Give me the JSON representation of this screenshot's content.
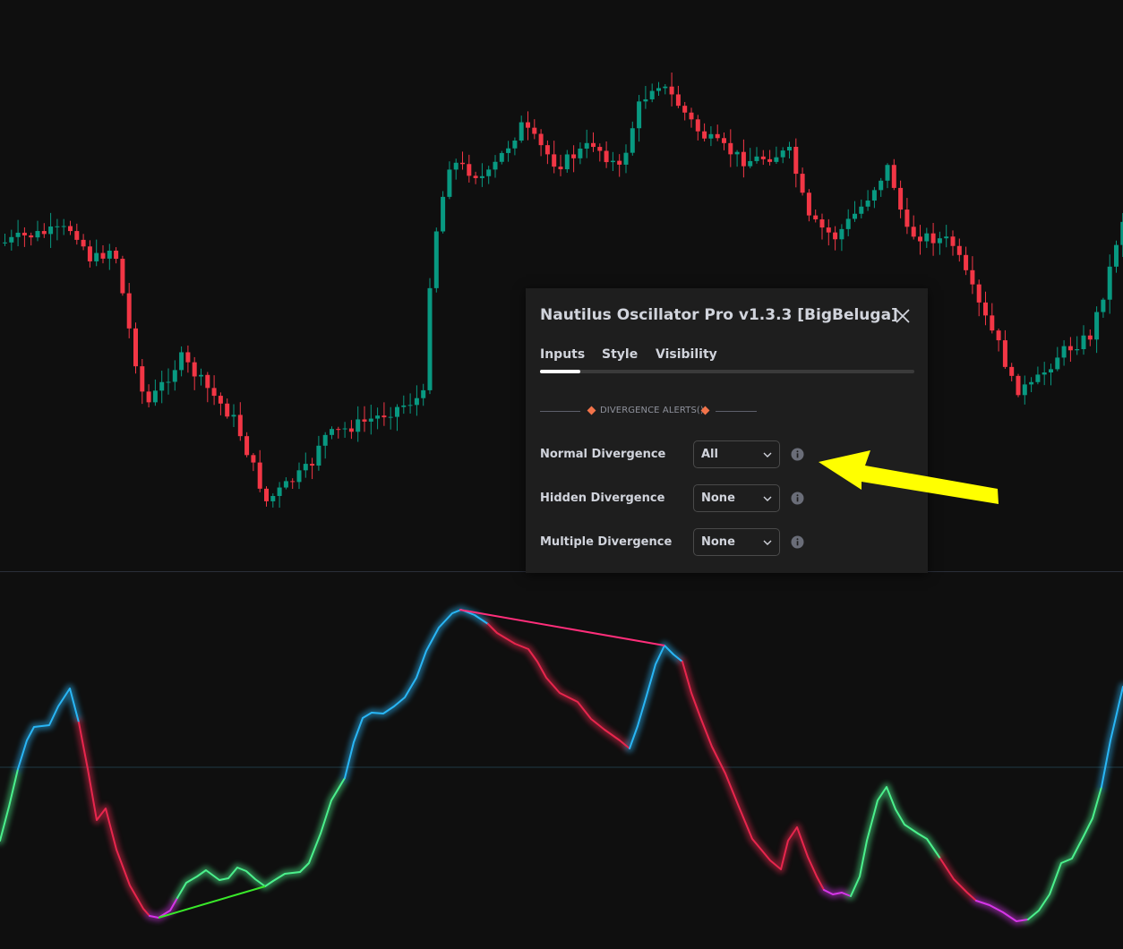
{
  "dialog": {
    "title": "Nautilus Oscillator Pro v1.3.3 [BigBeluga]",
    "tabs": [
      {
        "label": "Inputs",
        "active": true
      },
      {
        "label": "Style",
        "active": false
      },
      {
        "label": "Visibility",
        "active": false
      }
    ],
    "section_title": "DIVERGENCE ALERTS()",
    "settings": [
      {
        "label": "Normal Divergence",
        "value": "All"
      },
      {
        "label": "Hidden Divergence",
        "value": "None"
      },
      {
        "label": "Multiple Divergence",
        "value": "None"
      }
    ]
  },
  "colors": {
    "background": "#0f0f0f",
    "candle_up": "#089981",
    "candle_down": "#f23645",
    "osc_cyan": "#29b6f6",
    "osc_green": "#4bf08c",
    "osc_red": "#e8264d",
    "osc_magenta": "#d635e8",
    "bear_divergence": "#ff2e7a",
    "bull_divergence": "#39e82a",
    "annotation_arrow": "#ffff00",
    "section_diamond": "#f2734a"
  },
  "icons": {
    "close": "close-icon",
    "info": "info-icon",
    "dropdown": "chevron-down-icon",
    "section": "diamond-icon",
    "annotation": "arrow-icon"
  }
}
